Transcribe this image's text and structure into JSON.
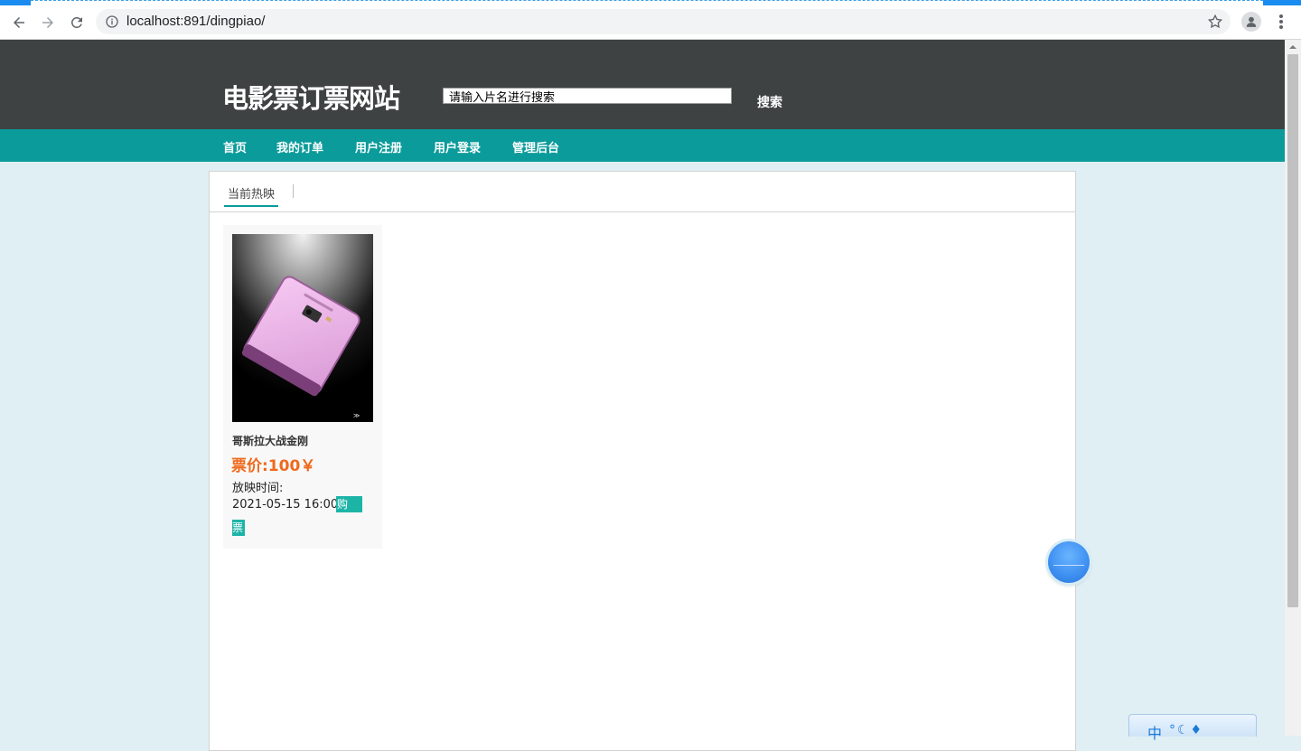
{
  "browser": {
    "url": "localhost:891/dingpiao/",
    "icons": [
      "back-arrow-icon",
      "forward-arrow-icon",
      "reload-icon",
      "info-icon",
      "star-icon",
      "profile-icon",
      "menu-dots-icon"
    ]
  },
  "header": {
    "site_title": "电影票订票网站",
    "search_placeholder": "请输入片名进行搜索",
    "search_button": "搜索"
  },
  "nav": {
    "items": [
      {
        "label": "首页"
      },
      {
        "label": "我的订单"
      },
      {
        "label": "用户注册"
      },
      {
        "label": "用户登录"
      },
      {
        "label": "管理后台"
      }
    ]
  },
  "content": {
    "tab_label": "当前热映",
    "movies": [
      {
        "name": "哥斯拉大战金刚",
        "price": "票价:100￥",
        "showtime_label": "放映时间:",
        "showtime": "2021-05-15 16:00",
        "buy_label_part1": "购",
        "buy_label_part2": "票"
      }
    ]
  },
  "ime": {
    "mode": "中"
  },
  "colors": {
    "header_bg": "#3e4243",
    "nav_bg": "#0b9b9b",
    "page_bg": "#e0eff3",
    "price": "#f0691b",
    "buy_button": "#1db4a8"
  }
}
